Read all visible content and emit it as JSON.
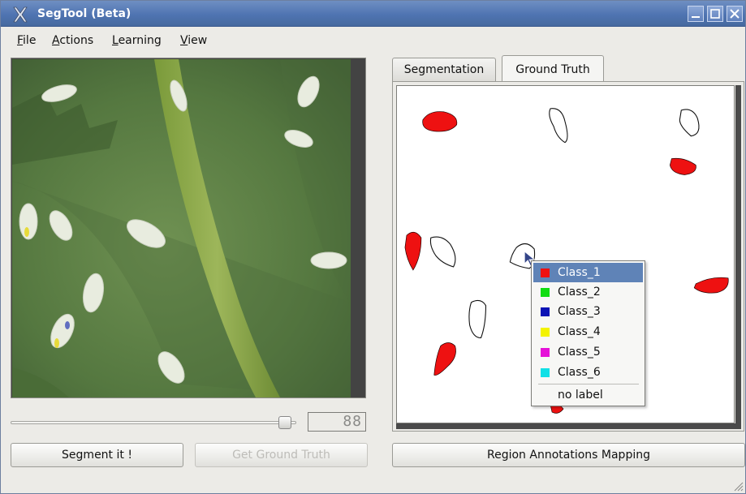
{
  "window": {
    "title": "SegTool (Beta)"
  },
  "menu": [
    {
      "underline": "F",
      "rest": "ile"
    },
    {
      "underline": "A",
      "rest": "ctions"
    },
    {
      "underline": "L",
      "rest": "earning"
    },
    {
      "underline": "V",
      "rest": "iew"
    }
  ],
  "display": {
    "lcd_text": "88"
  },
  "buttons": {
    "segment": "Segment it !",
    "ground_truth": "Get Ground Truth",
    "mapping": "Region Annotations Mapping"
  },
  "tabs": [
    {
      "label": "Segmentation",
      "active": false
    },
    {
      "label": "Ground Truth",
      "active": true
    }
  ],
  "context_menu": {
    "items": [
      {
        "label": "Class_1",
        "color": "#ee1111",
        "highlighted": true
      },
      {
        "label": "Class_2",
        "color": "#11dd11",
        "highlighted": false
      },
      {
        "label": "Class_3",
        "color": "#0b13b5",
        "highlighted": false
      },
      {
        "label": "Class_4",
        "color": "#f3f300",
        "highlighted": false
      },
      {
        "label": "Class_5",
        "color": "#e611d8",
        "highlighted": false
      },
      {
        "label": "Class_6",
        "color": "#11e0e6",
        "highlighted": false
      }
    ],
    "no_label": "no label"
  },
  "colors": {
    "titlebar": "#4f74b2",
    "highlight": "#5f83b7",
    "annotation_red": "#ee1111"
  }
}
